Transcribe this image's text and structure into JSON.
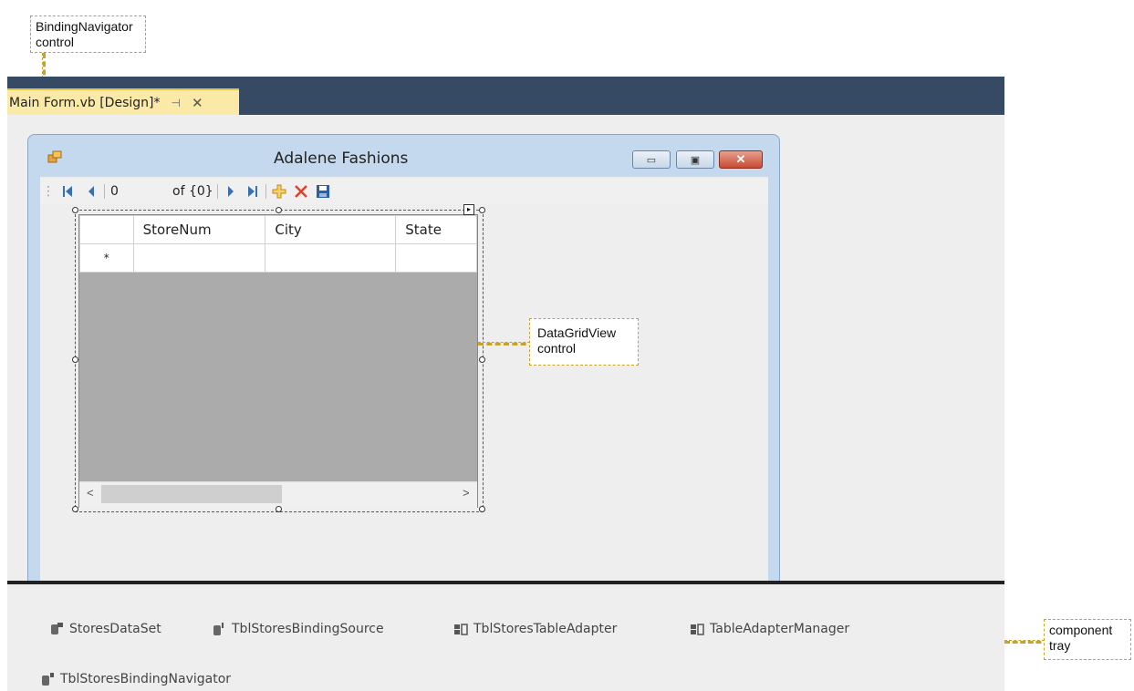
{
  "callouts": {
    "binding_navigator": [
      "BindingNavigator",
      "control"
    ],
    "datagridview": [
      "DataGridView",
      "control"
    ],
    "component_tray": [
      "component",
      "tray"
    ]
  },
  "document_tab": {
    "title": "Main Form.vb [Design]*",
    "pin_icon": "pin-icon",
    "close_icon": "close-icon"
  },
  "form": {
    "title": "Adalene Fashions",
    "icon": "form-icon",
    "buttons": [
      "minimize",
      "maximize",
      "close"
    ]
  },
  "navigator": {
    "position_value": "0",
    "count_label": "of {0}",
    "icons": [
      "move-first-icon",
      "move-previous-icon",
      "move-next-icon",
      "move-last-icon",
      "add-new-icon",
      "delete-icon",
      "save-icon"
    ]
  },
  "grid": {
    "columns": [
      "StoreNum",
      "City",
      "State"
    ],
    "new_row_marker": "*",
    "scroll_left": "<",
    "scroll_right": ">"
  },
  "tray": {
    "items": [
      {
        "label": "StoresDataSet",
        "icon": "dataset-icon"
      },
      {
        "label": "TblStoresBindingSource",
        "icon": "binding-source-icon"
      },
      {
        "label": "TblStoresTableAdapter",
        "icon": "table-adapter-icon"
      },
      {
        "label": "TableAdapterManager",
        "icon": "table-adapter-manager-icon"
      },
      {
        "label": "TblStoresBindingNavigator",
        "icon": "binding-navigator-icon"
      }
    ]
  },
  "colors": {
    "ide_bar": "#364a63",
    "tab_active": "#fbe9a8",
    "callout_border": "#c9a227",
    "grid_background": "#ababab"
  }
}
